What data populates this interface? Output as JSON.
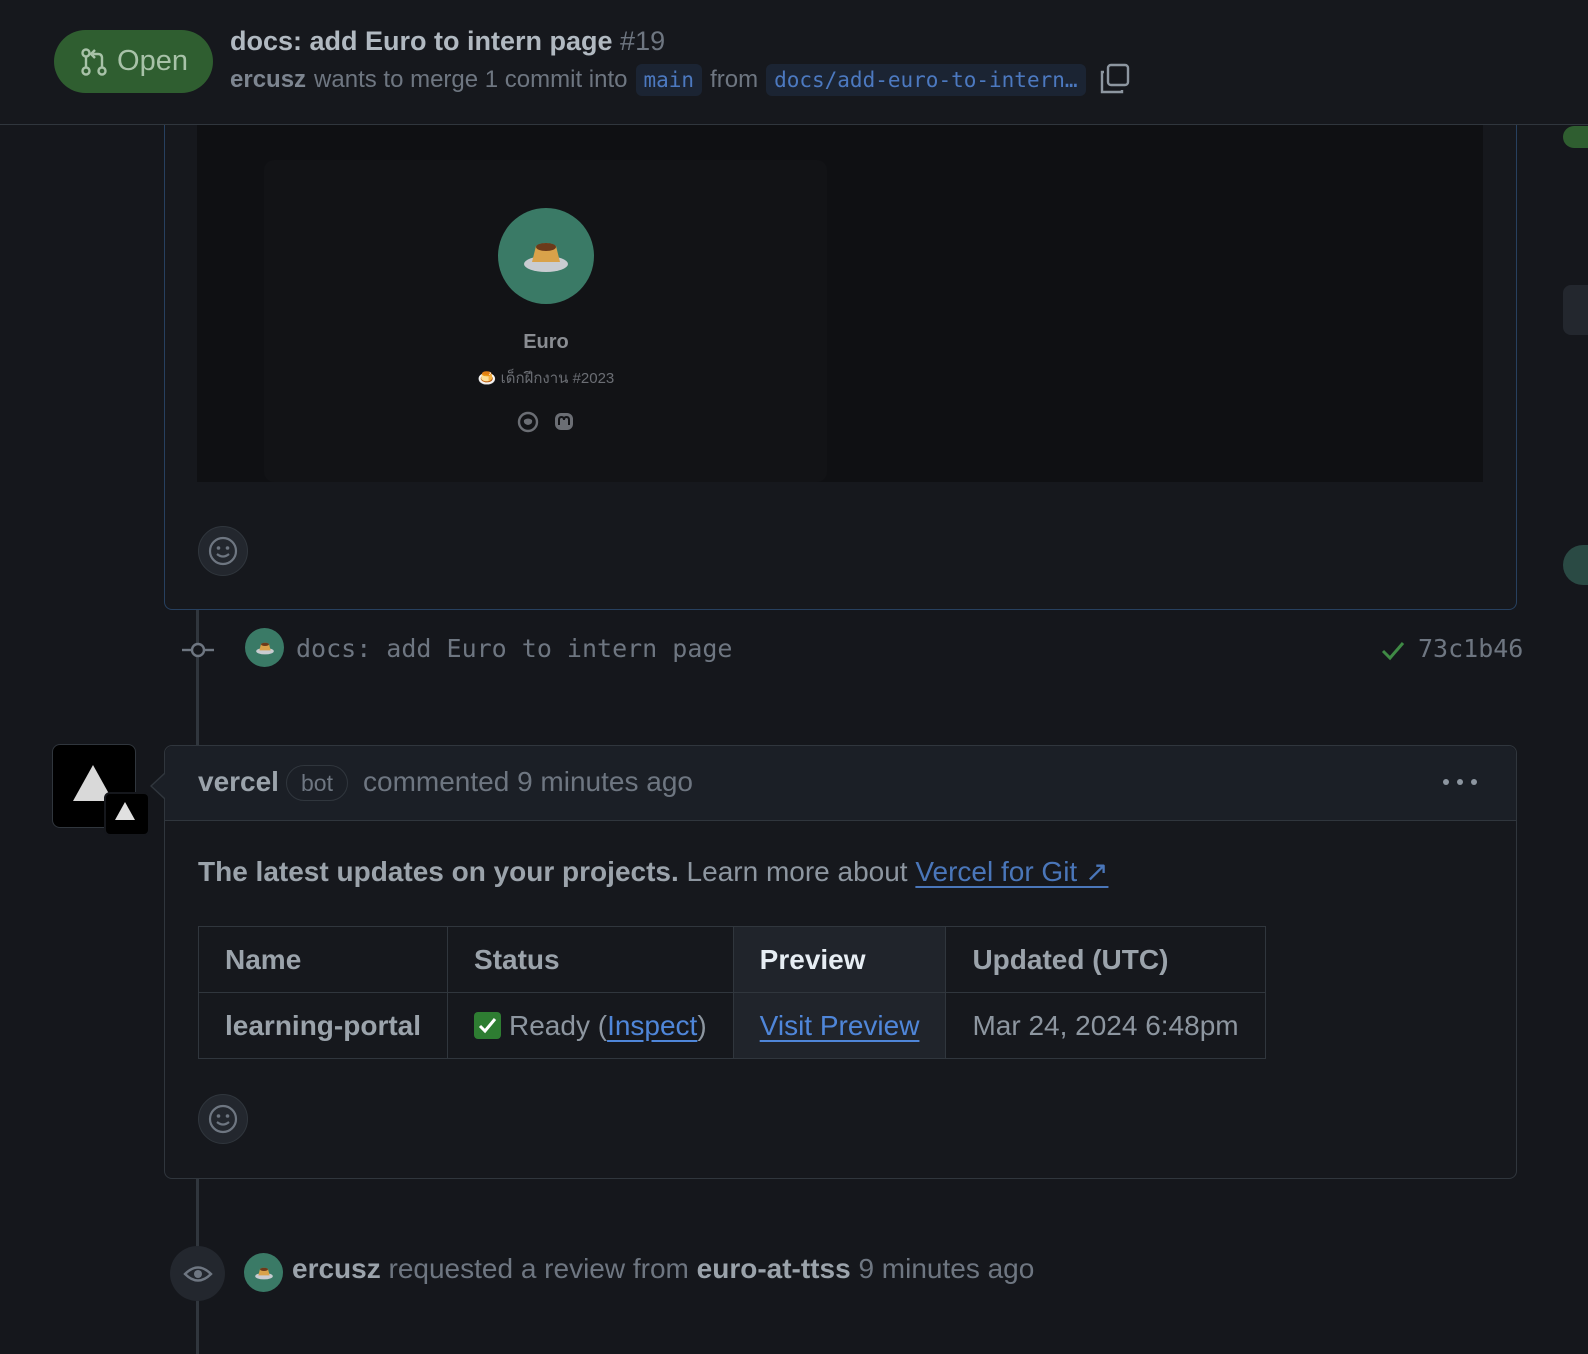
{
  "header": {
    "state_label": "Open",
    "title": "docs: add Euro to intern page",
    "number": "#19",
    "author": "ercusz",
    "merge_text": "wants to merge 1 commit into",
    "base_branch": "main",
    "from_text": "from",
    "head_branch": "docs/add-euro-to-intern…"
  },
  "profile_preview": {
    "name": "Euro",
    "role": "เด็กฝึกงาน #2023"
  },
  "commit": {
    "message": "docs: add Euro to intern page",
    "sha": "73c1b46"
  },
  "vercel_comment": {
    "author": "vercel",
    "badge": "bot",
    "meta": "commented 9 minutes ago",
    "intro_bold": "The latest updates on your projects.",
    "intro_rest": "Learn more about",
    "intro_link": "Vercel for Git ↗",
    "table": {
      "headers": [
        "Name",
        "Status",
        "Preview",
        "Updated (UTC)"
      ],
      "row": {
        "name": "learning-portal",
        "status_prefix": "Ready (",
        "status_link": "Inspect",
        "status_suffix": ")",
        "preview_link": "Visit Preview",
        "updated": "Mar 24, 2024 6:48pm"
      }
    }
  },
  "review_event": {
    "actor": "ercusz",
    "action": "requested a review from",
    "reviewer": "euro-at-ttss",
    "time": "9 minutes ago"
  },
  "colors": {
    "background": "#15171c",
    "open_badge": "#2f5e30",
    "link": "#4f86d9",
    "border": "#30363d"
  }
}
